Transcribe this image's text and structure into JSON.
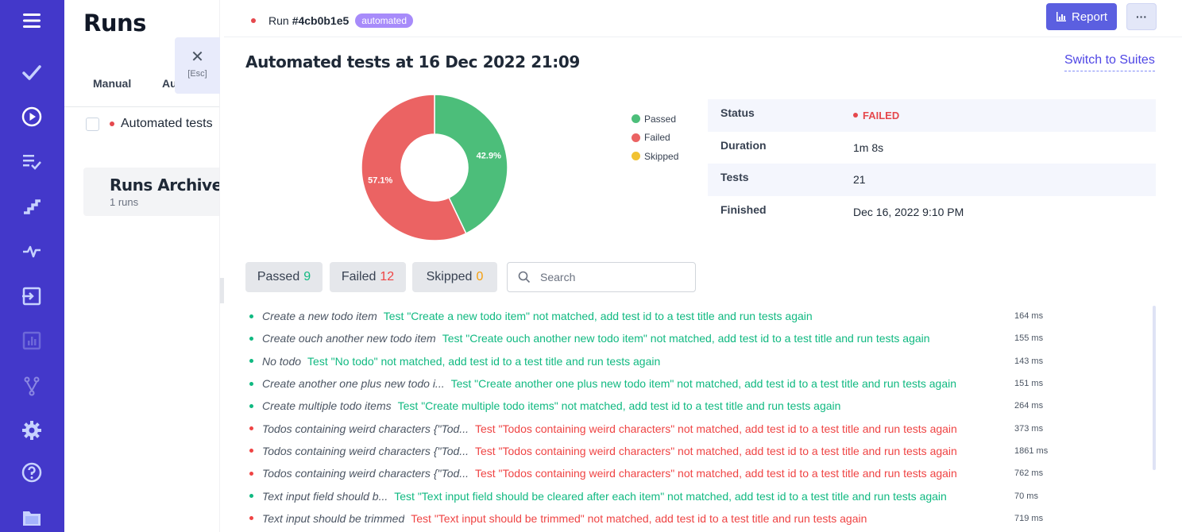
{
  "page": {
    "title": "Runs",
    "tabs": [
      "Manual",
      "Au"
    ],
    "run_item": "Automated tests",
    "archive_title": "Runs Archive",
    "archive_sub": "1 runs",
    "close_symbol": "✕",
    "close_hint": "[Esc]"
  },
  "nav_icons": [
    "menu-icon",
    "check-icon",
    "play-icon",
    "list-check-icon",
    "steps-icon",
    "pulse-icon",
    "import-icon",
    "analytics-icon",
    "branch-icon",
    "gear-icon",
    "help-icon",
    "folder-icon"
  ],
  "run": {
    "label": "Run",
    "id": "#4cb0b1e5",
    "badge": "automated",
    "report_label": "Report",
    "more_label": "···",
    "title": "Automated tests at 16 Dec 2022 21:09",
    "switch_label": "Switch to Suites"
  },
  "status": {
    "rows": [
      {
        "key": "Status",
        "value": "FAILED"
      },
      {
        "key": "Duration",
        "value": "1m 8s"
      },
      {
        "key": "Tests",
        "value": "21"
      },
      {
        "key": "Finished",
        "value": "Dec 16, 2022 9:10 PM"
      }
    ]
  },
  "chart_data": {
    "type": "pie",
    "categories": [
      "Passed",
      "Failed",
      "Skipped"
    ],
    "values": [
      42.9,
      57.1,
      0
    ],
    "data_labels": [
      "42.9%",
      "57.1%",
      ""
    ],
    "colors": [
      "#4cbe7a",
      "#eb6363",
      "#f1c232"
    ],
    "legend_position": "right"
  },
  "filters": [
    {
      "label": "Passed",
      "count": "9",
      "color": "#10b981"
    },
    {
      "label": "Failed",
      "count": "12",
      "color": "#ef4444"
    },
    {
      "label": "Skipped",
      "count": "0",
      "color": "#f59e0b"
    }
  ],
  "search": {
    "placeholder": "Search"
  },
  "tests": [
    {
      "title": "Create a new todo item",
      "message": "Test \"Create a new todo item\" not matched, add test id to a test title and run tests again",
      "time": "164 ms",
      "status": "passed"
    },
    {
      "title": "Create ouch another new todo item",
      "message": "Test \"Create ouch another new todo item\" not matched, add test id to a test title and run tests again",
      "time": "155 ms",
      "status": "passed"
    },
    {
      "title": "No todo",
      "message": "Test \"No todo\" not matched, add test id to a test title and run tests again",
      "time": "143 ms",
      "status": "passed"
    },
    {
      "title": "Create another one plus new todo i...",
      "message": "Test \"Create another one plus new todo item\" not matched, add test id to a test title and run tests again",
      "time": "151 ms",
      "status": "passed"
    },
    {
      "title": "Create multiple todo items",
      "message": "Test \"Create multiple todo items\" not matched, add test id to a test title and run tests again",
      "time": "264 ms",
      "status": "passed"
    },
    {
      "title": "Todos containing weird characters {\"Tod...",
      "message": "Test \"Todos containing weird characters\" not matched, add test id to a test title and run tests again",
      "time": "373 ms",
      "status": "failed"
    },
    {
      "title": "Todos containing weird characters {\"Tod...",
      "message": "Test \"Todos containing weird characters\" not matched, add test id to a test title and run tests again",
      "time": "1861 ms",
      "status": "failed"
    },
    {
      "title": "Todos containing weird characters {\"Tod...",
      "message": "Test \"Todos containing weird characters\" not matched, add test id to a test title and run tests again",
      "time": "762 ms",
      "status": "failed"
    },
    {
      "title": "Text input field should b...",
      "message": "Test \"Text input field should be cleared after each item\" not matched, add test id to a test title and run tests again",
      "time": "70 ms",
      "status": "passed"
    },
    {
      "title": "Text input should be trimmed",
      "message": "Test \"Text input should be trimmed\" not matched, add test id to a test title and run tests again",
      "time": "719 ms",
      "status": "failed"
    }
  ]
}
